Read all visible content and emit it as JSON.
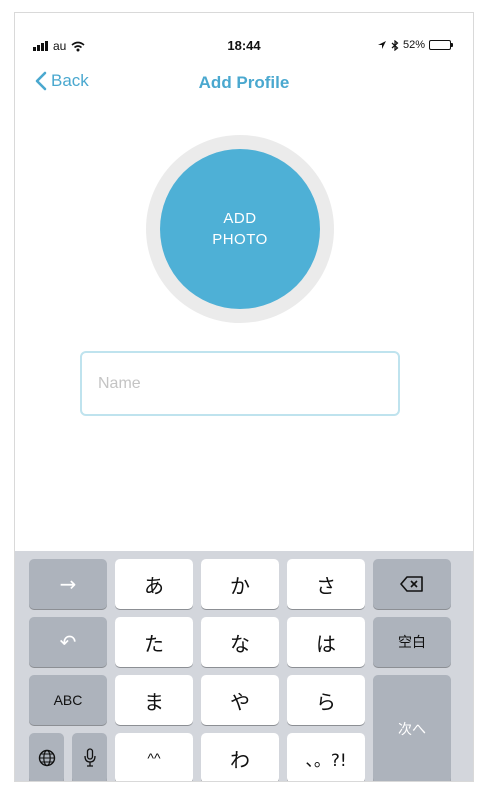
{
  "status_bar": {
    "carrier": "au",
    "time": "18:44",
    "battery": "52%",
    "battery_level": 0.52
  },
  "nav": {
    "back_label": "Back",
    "title": "Add Profile"
  },
  "photo": {
    "line1": "ADD",
    "line2": "PHOTO"
  },
  "form": {
    "name_placeholder": "Name",
    "name_value": ""
  },
  "keyboard": {
    "row1": [
      "→",
      "あ",
      "か",
      "さ",
      "⌫"
    ],
    "row2": [
      "↶",
      "た",
      "な",
      "は",
      "空白"
    ],
    "row3": [
      "ABC",
      "ま",
      "や",
      "ら"
    ],
    "next_label": "次へ",
    "row4": [
      "globe",
      "mic",
      "^^",
      "わ",
      "、。?!"
    ]
  },
  "colors": {
    "accent": "#4aa8cf",
    "photo_fill": "#4eb0d6",
    "keyboard_bg": "#d3d6dc",
    "fn_key": "#adb3bc"
  }
}
